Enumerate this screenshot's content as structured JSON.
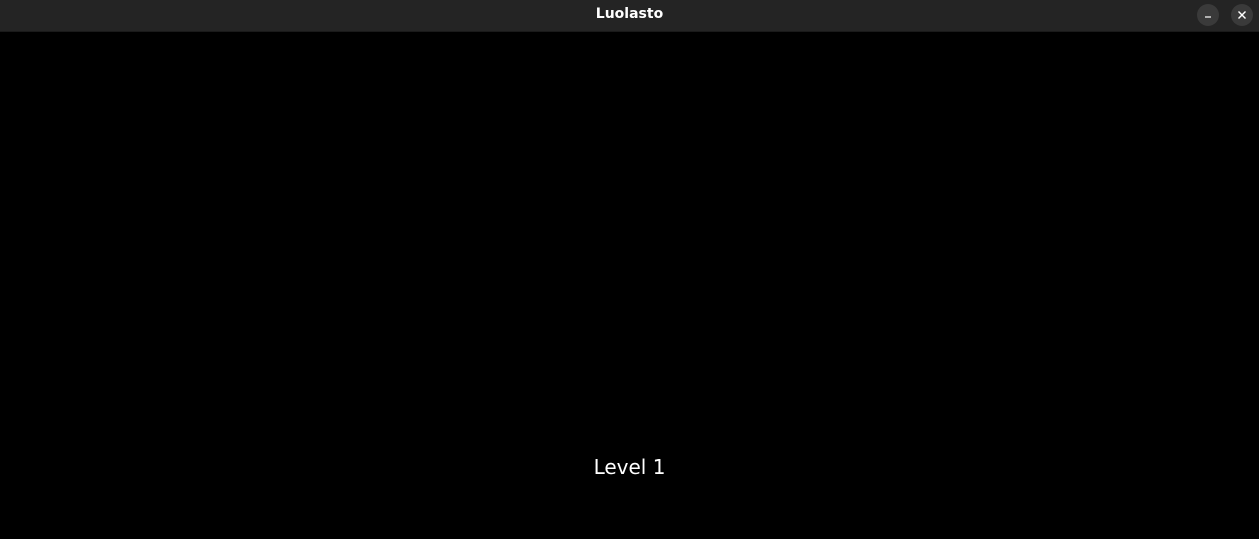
{
  "window": {
    "title": "Luolasto",
    "buttons": {
      "minimize_icon": "minimize-icon",
      "close_icon": "close-icon"
    },
    "titlebar_color": "#242424"
  },
  "game": {
    "background_color": "#000000",
    "level_text": "Level 1"
  }
}
